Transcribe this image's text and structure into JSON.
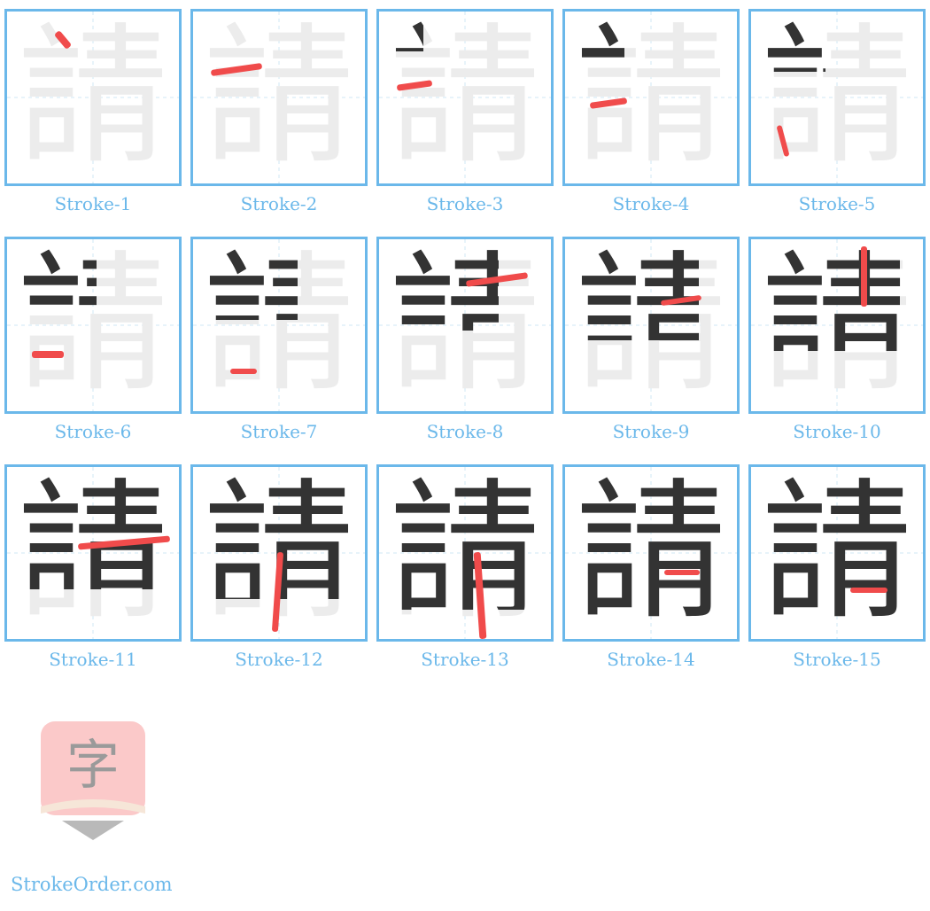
{
  "character": "請",
  "strokes": [
    {
      "label": "Stroke-1",
      "step": 1
    },
    {
      "label": "Stroke-2",
      "step": 2
    },
    {
      "label": "Stroke-3",
      "step": 3
    },
    {
      "label": "Stroke-4",
      "step": 4
    },
    {
      "label": "Stroke-5",
      "step": 5
    },
    {
      "label": "Stroke-6",
      "step": 6
    },
    {
      "label": "Stroke-7",
      "step": 7
    },
    {
      "label": "Stroke-8",
      "step": 8
    },
    {
      "label": "Stroke-9",
      "step": 9
    },
    {
      "label": "Stroke-10",
      "step": 10
    },
    {
      "label": "Stroke-11",
      "step": 11
    },
    {
      "label": "Stroke-12",
      "step": 12
    },
    {
      "label": "Stroke-13",
      "step": 13
    },
    {
      "label": "Stroke-14",
      "step": 14
    },
    {
      "label": "Stroke-15",
      "step": 15
    }
  ],
  "total_strokes": 15,
  "logo": {
    "glyph": "字",
    "icon": "zi-logo-icon"
  },
  "site": {
    "name": "StrokeOrder.com"
  },
  "colors": {
    "border": "#6bb8ea",
    "highlight": "#f04b4b",
    "drawn": "#333333",
    "ghost": "#ececec"
  }
}
